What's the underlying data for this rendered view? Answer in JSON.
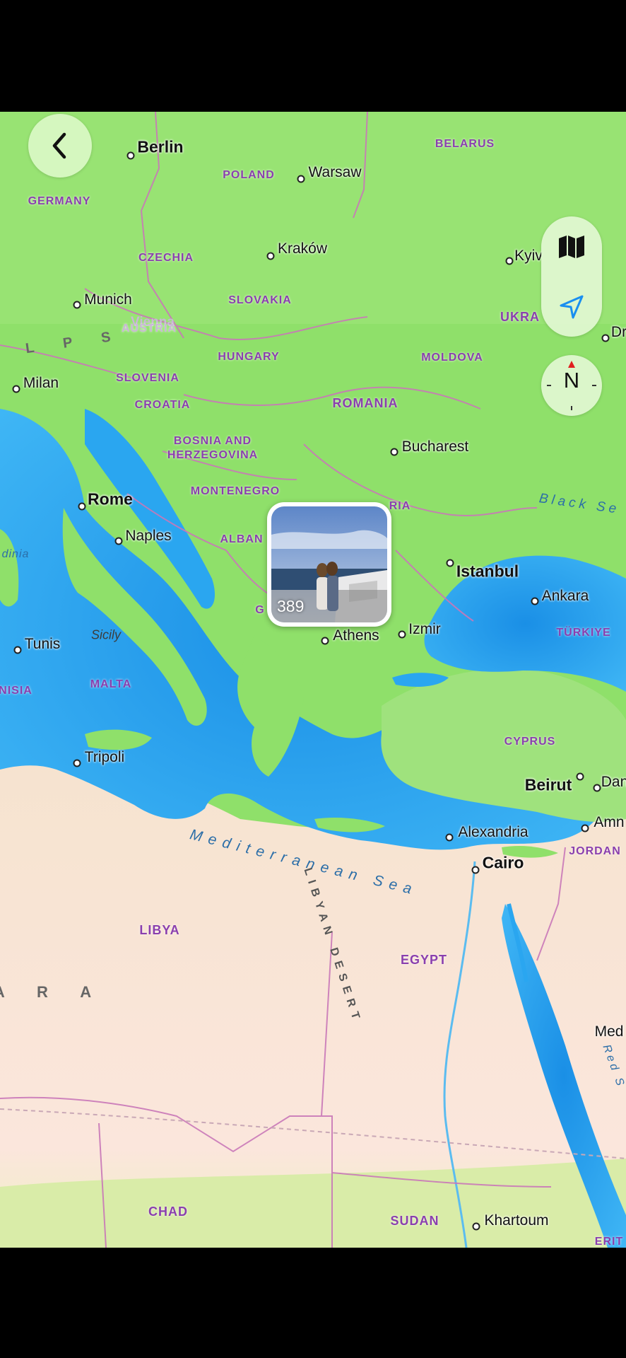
{
  "navigation": {
    "back_icon": "chevron-left-icon"
  },
  "controls": {
    "map_mode_icon": "map-icon",
    "locate_icon": "location-arrow-icon",
    "compass_label": "N"
  },
  "photo_pin": {
    "count": "389"
  },
  "map": {
    "cities": {
      "berlin": "Berlin",
      "warsaw": "Warsaw",
      "krakow": "Kraków",
      "kyiv": "Kyiv",
      "munich": "Munich",
      "milan": "Milan",
      "bucharest": "Bucharest",
      "rome": "Rome",
      "naples": "Naples",
      "istanbul": "Istanbul",
      "ankara": "Ankara",
      "izmir": "Izmir",
      "athens": "Athens",
      "tunis": "Tunis",
      "tripoli": "Tripoli",
      "beirut": "Beirut",
      "damascus_partial": "Dan",
      "amman_partial": "Amn",
      "dnipro_partial": "Dr",
      "alexandria": "Alexandria",
      "cairo": "Cairo",
      "khartoum": "Khartoum",
      "medina_partial": "Med",
      "vienna": "Vienna"
    },
    "countries": {
      "germany": "GERMANY",
      "poland": "POLAND",
      "belarus": "BELARUS",
      "czechia": "CZECHIA",
      "slovakia": "SLOVAKIA",
      "ukraine_partial": "UKRA",
      "austria": "AUSTRIA",
      "hungary": "HUNGARY",
      "moldova": "MOLDOVA",
      "slovenia": "SLOVENIA",
      "croatia": "CROATIA",
      "romania": "ROMANIA",
      "bosnia_line1": "BOSNIA AND",
      "bosnia_line2": "HERZEGOVINA",
      "montenegro": "MONTENEGRO",
      "bulgaria_partial": "RIA",
      "albania_partial": "ALBAN",
      "greece_partial": "G",
      "turkiye": "TÜRKIYE",
      "malta": "MALTA",
      "tunisia_partial": "NISIA",
      "cyprus": "CYPRUS",
      "jordan": "JORDAN",
      "libya": "LIBYA",
      "egypt": "EGYPT",
      "chad": "CHAD",
      "sudan": "SUDAN",
      "eritrea_partial": "ERIT"
    },
    "water": {
      "mediterranean": "Mediterranean Sea",
      "black_sea": "Black Se",
      "tyrrhenian_partial": "dinia",
      "red_sea_partial": "Red S"
    },
    "features": {
      "alps": "A L P S",
      "sicily": "Sicily",
      "sahara_partial": "A R A",
      "libyan_desert": "LIBYAN DESERT"
    }
  }
}
